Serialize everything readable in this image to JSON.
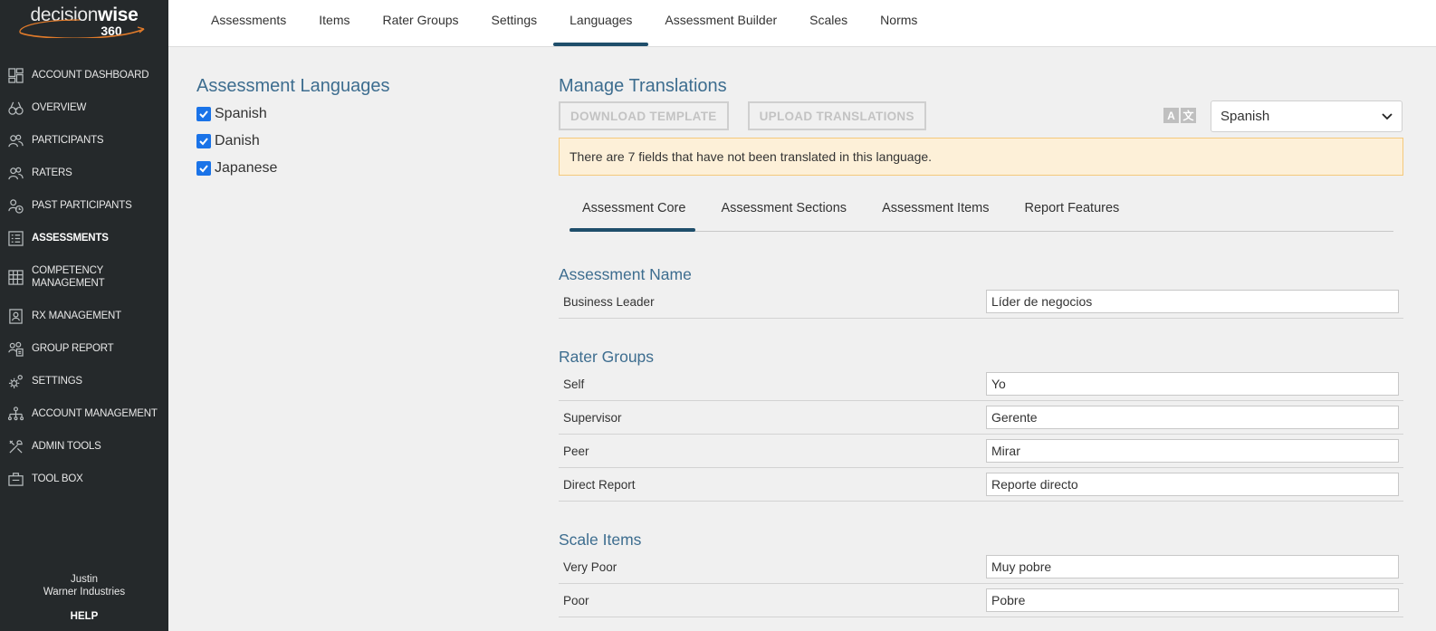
{
  "brand": {
    "name_light": "decision",
    "name_bold": "wise",
    "sub": "360"
  },
  "sidebar": {
    "items": [
      {
        "label": "ACCOUNT DASHBOARD",
        "icon": "dashboard-icon"
      },
      {
        "label": "OVERVIEW",
        "icon": "binoculars-icon"
      },
      {
        "label": "PARTICIPANTS",
        "icon": "users-icon"
      },
      {
        "label": "RATERS",
        "icon": "users-icon"
      },
      {
        "label": "PAST PARTICIPANTS",
        "icon": "users-history-icon"
      },
      {
        "label": "ASSESSMENTS",
        "icon": "checklist-icon",
        "active": true
      },
      {
        "label": "COMPETENCY MANAGEMENT",
        "icon": "grid-icon"
      },
      {
        "label": "RX MANAGEMENT",
        "icon": "person-document-icon"
      },
      {
        "label": "GROUP REPORT",
        "icon": "group-report-icon"
      },
      {
        "label": "SETTINGS",
        "icon": "gear-icon"
      },
      {
        "label": "ACCOUNT MANAGEMENT",
        "icon": "org-chart-icon"
      },
      {
        "label": "ADMIN TOOLS",
        "icon": "tools-icon"
      },
      {
        "label": "TOOL BOX",
        "icon": "toolbox-icon"
      }
    ],
    "user_name": "Justin",
    "company": "Warner Industries",
    "help": "HELP"
  },
  "topnav": {
    "items": [
      "Assessments",
      "Items",
      "Rater Groups",
      "Settings",
      "Languages",
      "Assessment Builder",
      "Scales",
      "Norms"
    ],
    "active_index": 4
  },
  "assessment_languages": {
    "title": "Assessment Languages",
    "languages": [
      {
        "name": "Spanish",
        "checked": true
      },
      {
        "name": "Danish",
        "checked": true
      },
      {
        "name": "Japanese",
        "checked": true
      }
    ]
  },
  "manage_translations": {
    "title": "Manage Translations",
    "download_button": "DOWNLOAD TEMPLATE",
    "upload_button": "UPLOAD TRANSLATIONS",
    "translate_icon_a": "A",
    "translate_icon_b": "文",
    "selected_language": "Spanish",
    "warning": "There are 7 fields that have not been translated in this language.",
    "tabs": [
      "Assessment Core",
      "Assessment Sections",
      "Assessment Items",
      "Report Features"
    ],
    "active_tab": 0
  },
  "groups": {
    "assessment_name": {
      "title": "Assessment Name",
      "rows": [
        {
          "label": "Business Leader",
          "value": "Líder de negocios"
        }
      ]
    },
    "rater_groups": {
      "title": "Rater Groups",
      "rows": [
        {
          "label": "Self",
          "value": "Yo"
        },
        {
          "label": "Supervisor",
          "value": "Gerente"
        },
        {
          "label": "Peer",
          "value": "Mirar"
        },
        {
          "label": "Direct Report",
          "value": "Reporte directo"
        }
      ]
    },
    "scale_items": {
      "title": "Scale Items",
      "rows": [
        {
          "label": "Very Poor",
          "value": "Muy pobre"
        },
        {
          "label": "Poor",
          "value": "Pobre"
        }
      ]
    }
  },
  "colors": {
    "sidebar_bg": "#25292b",
    "accent": "#1f4e6b",
    "section_title": "#3d6d8f",
    "checkbox": "#1a73e8",
    "warning_bg": "#fdf0d8",
    "warning_border": "#f4c97b"
  }
}
